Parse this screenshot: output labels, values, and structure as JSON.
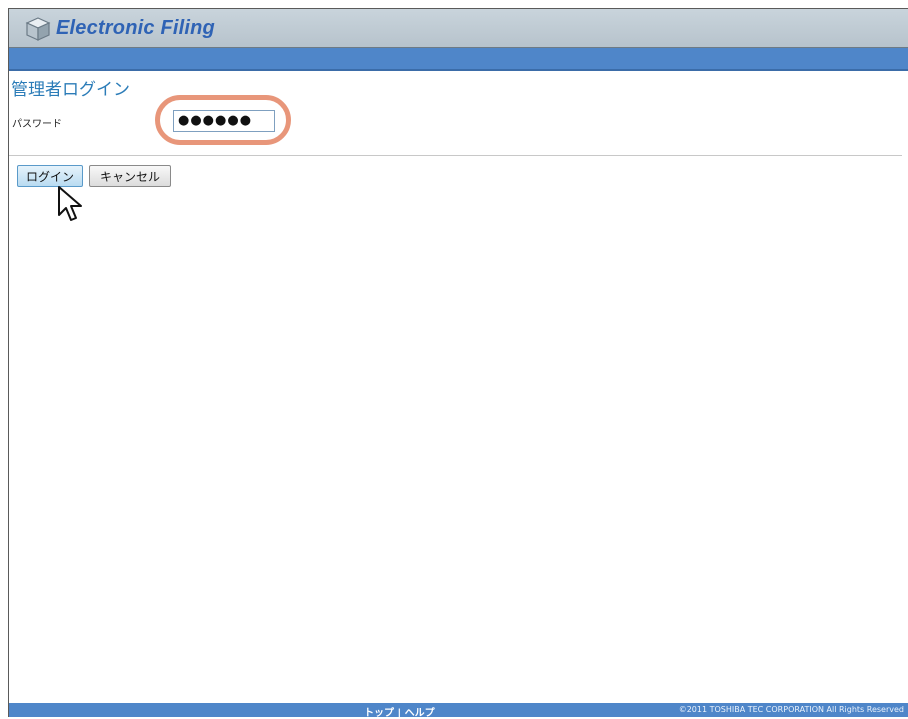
{
  "header": {
    "app_title": "Electronic Filing",
    "logo_icon": "cube-icon"
  },
  "page": {
    "title": "管理者ログイン",
    "password_label": "パスワード",
    "password_value": "●●●●●●"
  },
  "buttons": {
    "login": "ログイン",
    "cancel": "キャンセル"
  },
  "footer": {
    "links": "トップ | ヘルプ",
    "copyright": "©2011 TOSHIBA TEC CORPORATION All Rights Reserved"
  },
  "colors": {
    "header_bg": "#c9d4dc",
    "band_blue": "#4f86c9",
    "title_blue": "#2f63b5",
    "highlight": "#e8967a"
  }
}
